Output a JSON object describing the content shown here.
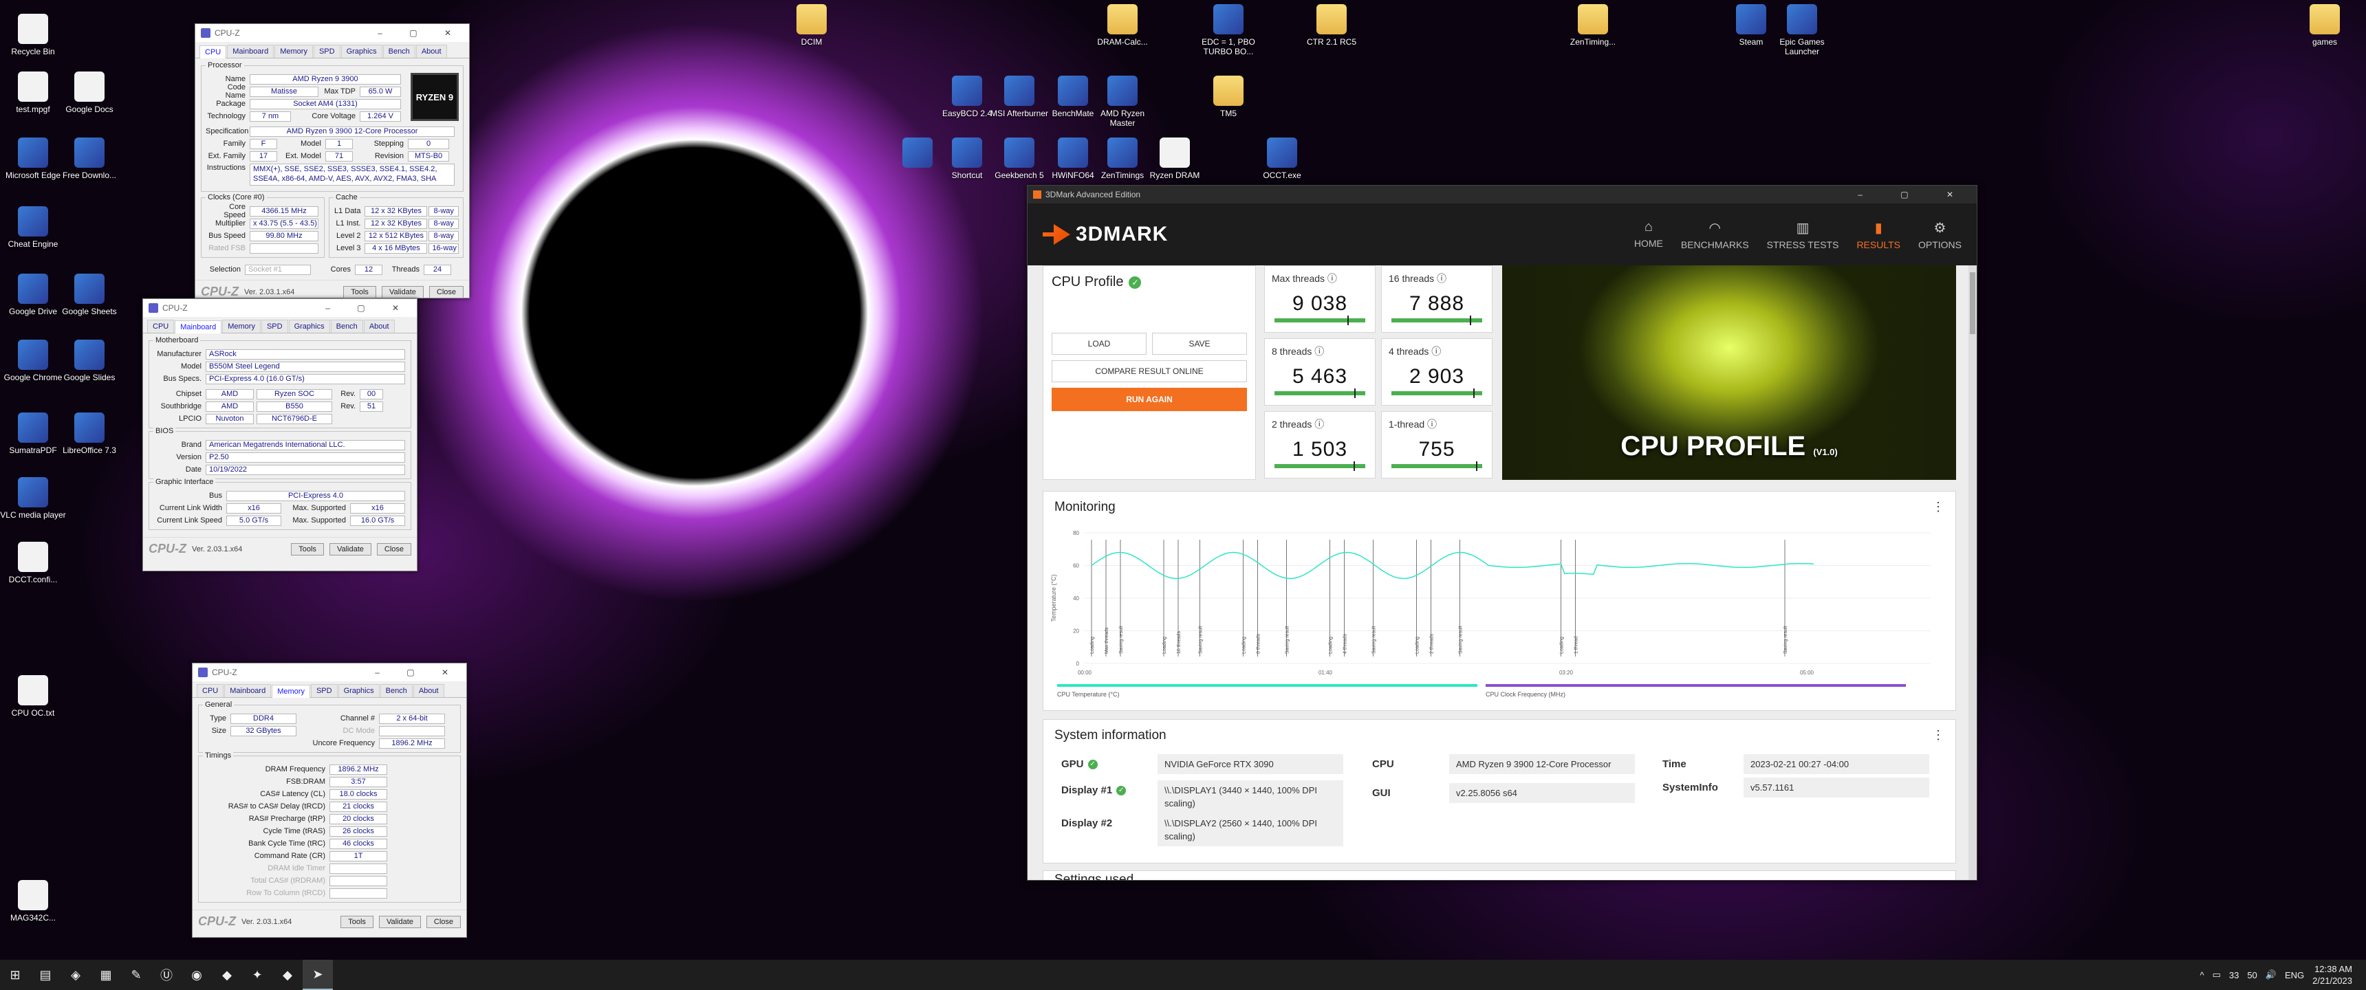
{
  "desktop_icons": [
    {
      "label": "Recycle Bin",
      "icon": "recycle-bin-icon",
      "kind": "file"
    },
    {
      "label": "test.mpgf",
      "icon": "file-icon",
      "kind": "file"
    },
    {
      "label": "Google Docs",
      "icon": "google-docs-icon",
      "kind": "file"
    },
    {
      "label": "Microsoft Edge",
      "icon": "edge-icon",
      "kind": "app"
    },
    {
      "label": "Free Downlo...",
      "icon": "download-icon",
      "kind": "app"
    },
    {
      "label": "Cheat Engine",
      "icon": "cheat-engine-icon",
      "kind": "app"
    },
    {
      "label": "Google Drive",
      "icon": "google-drive-icon",
      "kind": "app"
    },
    {
      "label": "Google Sheets",
      "icon": "google-sheets-icon",
      "kind": "app"
    },
    {
      "label": "Google Chrome",
      "icon": "chrome-icon",
      "kind": "app"
    },
    {
      "label": "Google Slides",
      "icon": "google-slides-icon",
      "kind": "app"
    },
    {
      "label": "SumatraPDF",
      "icon": "pdf-icon",
      "kind": "app"
    },
    {
      "label": "LibreOffice 7.3",
      "icon": "libreoffice-icon",
      "kind": "app"
    },
    {
      "label": "VLC media player",
      "icon": "vlc-icon",
      "kind": "app"
    },
    {
      "label": "DCCT.confi...",
      "icon": "file-icon",
      "kind": "file"
    },
    {
      "label": "CPU OC.txt",
      "icon": "text-file-icon",
      "kind": "file"
    },
    {
      "label": "MAG342C...",
      "icon": "file-icon",
      "kind": "file"
    },
    {
      "label": "DCIM",
      "icon": "folder-icon",
      "kind": "folder"
    },
    {
      "label": "DRAM-Calc...",
      "icon": "folder-icon",
      "kind": "folder"
    },
    {
      "label": "EDC = 1, PBO TURBO BO...",
      "icon": "chrome-icon",
      "kind": "app"
    },
    {
      "label": "CTR 2.1 RC5",
      "icon": "folder-icon",
      "kind": "folder"
    },
    {
      "label": "ZenTiming...",
      "icon": "folder-icon",
      "kind": "folder"
    },
    {
      "label": "Steam",
      "icon": "steam-icon",
      "kind": "app"
    },
    {
      "label": "Epic Games Launcher",
      "icon": "epic-games-icon",
      "kind": "app"
    },
    {
      "label": "games",
      "icon": "folder-icon",
      "kind": "folder"
    },
    {
      "label": "EasyBCD 2.4",
      "icon": "easybcd-icon",
      "kind": "app"
    },
    {
      "label": "MSI Afterburner",
      "icon": "afterburner-icon",
      "kind": "app"
    },
    {
      "label": "BenchMate",
      "icon": "benchmate-icon",
      "kind": "app"
    },
    {
      "label": "AMD Ryzen Master",
      "icon": "ryzen-master-icon",
      "kind": "app"
    },
    {
      "label": "TM5",
      "icon": "folder-icon",
      "kind": "folder"
    },
    {
      "label": "",
      "icon": "app-icon",
      "kind": "app"
    },
    {
      "label": "Shortcut",
      "icon": "shortcut-icon",
      "kind": "app"
    },
    {
      "label": "Geekbench 5",
      "icon": "geekbench-icon",
      "kind": "app"
    },
    {
      "label": "HWiNFO64",
      "icon": "hwinfo-icon",
      "kind": "app"
    },
    {
      "label": "ZenTimings",
      "icon": "zentimings-icon",
      "kind": "app"
    },
    {
      "label": "Ryzen DRAM",
      "icon": "file-icon",
      "kind": "file"
    },
    {
      "label": "OCCT.exe",
      "icon": "occt-icon",
      "kind": "app"
    }
  ],
  "cpuz_cpu": {
    "title": "CPU-Z",
    "tabs": [
      "CPU",
      "Mainboard",
      "Memory",
      "SPD",
      "Graphics",
      "Bench",
      "About"
    ],
    "group_processor": "Processor",
    "name_l": "Name",
    "name": "AMD Ryzen 9 3900",
    "codename_l": "Code Name",
    "codename": "Matisse",
    "maxtdp_l": "Max TDP",
    "maxtdp": "65.0 W",
    "package_l": "Package",
    "package": "Socket AM4 (1331)",
    "tech_l": "Technology",
    "tech": "7 nm",
    "voltage_l": "Core Voltage",
    "voltage": "1.264 V",
    "spec_l": "Specification",
    "spec": "AMD Ryzen 9 3900 12-Core Processor",
    "family_l": "Family",
    "family": "F",
    "model_l": "Model",
    "model": "1",
    "stepping_l": "Stepping",
    "stepping": "0",
    "extfamily_l": "Ext. Family",
    "extfamily": "17",
    "extmodel_l": "Ext. Model",
    "extmodel": "71",
    "revision_l": "Revision",
    "revision": "MTS-B0",
    "instr_l": "Instructions",
    "instr": "MMX(+), SSE, SSE2, SSE3, SSSE3, SSE4.1, SSE4.2, SSE4A, x86-64, AMD-V, AES, AVX, AVX2, FMA3, SHA",
    "group_clocks": "Clocks (Core #0)",
    "group_cache": "Cache",
    "corespeed_l": "Core Speed",
    "corespeed": "4366.15 MHz",
    "mult_l": "Multiplier",
    "mult": "x 43.75 (5.5 - 43.5)",
    "bus_l": "Bus Speed",
    "bus": "99.80 MHz",
    "fsb_l": "Rated FSB",
    "fsb": "",
    "l1d_l": "L1 Data",
    "l1d": "12 x 32 KBytes",
    "l1d_w": "8-way",
    "l1i_l": "L1 Inst.",
    "l1i": "12 x 32 KBytes",
    "l1i_w": "8-way",
    "l2_l": "Level 2",
    "l2": "12 x 512 KBytes",
    "l2_w": "8-way",
    "l3_l": "Level 3",
    "l3": "4 x 16 MBytes",
    "l3_w": "16-way",
    "selection_l": "Selection",
    "selection": "Socket #1",
    "cores_l": "Cores",
    "cores": "12",
    "threads_l": "Threads",
    "threads": "24",
    "logo": "CPU-Z",
    "version": "Ver. 2.03.1.x64",
    "tools": "Tools",
    "validate": "Validate",
    "close": "Close",
    "badge": "RYZEN 9"
  },
  "cpuz_mb": {
    "title": "CPU-Z",
    "tabs": [
      "CPU",
      "Mainboard",
      "Memory",
      "SPD",
      "Graphics",
      "Bench",
      "About"
    ],
    "group_mb": "Motherboard",
    "manu_l": "Manufacturer",
    "manu": "ASRock",
    "model_l": "Model",
    "model": "B550M Steel Legend",
    "busspecs_l": "Bus Specs.",
    "busspecs": "PCI-Express 4.0 (16.0 GT/s)",
    "chipset_l": "Chipset",
    "chipset_a": "AMD",
    "chipset_b": "Ryzen SOC",
    "chipset_rev_l": "Rev.",
    "chipset_rev": "00",
    "south_l": "Southbridge",
    "south_a": "AMD",
    "south_b": "B550",
    "south_rev_l": "Rev.",
    "south_rev": "51",
    "lpcio_l": "LPCIO",
    "lpcio_a": "Nuvoton",
    "lpcio_b": "NCT6796D-E",
    "group_bios": "BIOS",
    "brand_l": "Brand",
    "brand": "American Megatrends International LLC.",
    "ver_l": "Version",
    "ver": "P2.50",
    "date_l": "Date",
    "date": "10/19/2022",
    "group_gi": "Graphic Interface",
    "gbus_l": "Bus",
    "gbus": "PCI-Express 4.0",
    "clw_l": "Current Link Width",
    "clw": "x16",
    "msw_l": "Max. Supported",
    "msw": "x16",
    "cls_l": "Current Link Speed",
    "cls": "5.0 GT/s",
    "mss_l": "Max. Supported",
    "mss": "16.0 GT/s",
    "logo": "CPU-Z",
    "version": "Ver. 2.03.1.x64",
    "tools": "Tools",
    "validate": "Validate",
    "close": "Close"
  },
  "cpuz_mem": {
    "title": "CPU-Z",
    "tabs": [
      "CPU",
      "Mainboard",
      "Memory",
      "SPD",
      "Graphics",
      "Bench",
      "About"
    ],
    "group_general": "General",
    "type_l": "Type",
    "type": "DDR4",
    "chan_l": "Channel #",
    "chan": "2 x 64-bit",
    "size_l": "Size",
    "size": "32 GBytes",
    "dcmode_l": "DC Mode",
    "dcmode": "",
    "uncore_l": "Uncore Frequency",
    "uncore": "1896.2 MHz",
    "group_timings": "Timings",
    "timings": [
      {
        "l": "DRAM Frequency",
        "v": "1896.2 MHz",
        "dim": false
      },
      {
        "l": "FSB:DRAM",
        "v": "3:57",
        "dim": false
      },
      {
        "l": "CAS# Latency (CL)",
        "v": "18.0 clocks",
        "dim": false
      },
      {
        "l": "RAS# to CAS# Delay (tRCD)",
        "v": "21 clocks",
        "dim": false
      },
      {
        "l": "RAS# Precharge (tRP)",
        "v": "20 clocks",
        "dim": false
      },
      {
        "l": "Cycle Time (tRAS)",
        "v": "26 clocks",
        "dim": false
      },
      {
        "l": "Bank Cycle Time (tRC)",
        "v": "46 clocks",
        "dim": false
      },
      {
        "l": "Command Rate (CR)",
        "v": "1T",
        "dim": false
      },
      {
        "l": "DRAM Idle Timer",
        "v": "",
        "dim": true
      },
      {
        "l": "Total CAS# (tRDRAM)",
        "v": "",
        "dim": true
      },
      {
        "l": "Row To Column (tRCD)",
        "v": "",
        "dim": true
      }
    ],
    "logo": "CPU-Z",
    "version": "Ver. 2.03.1.x64",
    "tools": "Tools",
    "validate": "Validate",
    "close": "Close"
  },
  "tdm": {
    "window_title": "3DMark Advanced Edition",
    "logo": "3DMARK",
    "nav": [
      {
        "label": "HOME",
        "icon": "home-icon",
        "glyph": "⌂",
        "active": false
      },
      {
        "label": "BENCHMARKS",
        "icon": "benchmarks-icon",
        "glyph": "◠",
        "active": false
      },
      {
        "label": "STRESS TESTS",
        "icon": "stress-tests-icon",
        "glyph": "▥",
        "active": false
      },
      {
        "label": "RESULTS",
        "icon": "results-icon",
        "glyph": "▮",
        "active": true
      },
      {
        "label": "OPTIONS",
        "icon": "options-icon",
        "glyph": "⚙",
        "active": false
      }
    ],
    "test_name": "CPU Profile",
    "load": "LOAD",
    "save": "SAVE",
    "compare": "COMPARE RESULT ONLINE",
    "run_again": "RUN AGAIN",
    "scores": [
      {
        "label": "Max threads",
        "value": "9 038",
        "marker": 0.8
      },
      {
        "label": "16 threads",
        "value": "7 888",
        "marker": 0.86
      },
      {
        "label": "8 threads",
        "value": "5 463",
        "marker": 0.88
      },
      {
        "label": "4 threads",
        "value": "2 903",
        "marker": 0.9
      },
      {
        "label": "2 threads",
        "value": "1 503",
        "marker": 0.87
      },
      {
        "label": "1-thread",
        "value": "755",
        "marker": 0.93
      }
    ],
    "hero_title": "CPU PROFILE",
    "hero_ver": "(V1.0)",
    "monitoring": {
      "title": "Monitoring",
      "ylabel": "Temperature (°C)",
      "yticks": [
        "80",
        "60",
        "40",
        "20",
        "0"
      ],
      "xticks": [
        "00:00",
        "01:40",
        "03:20",
        "05:00"
      ],
      "markers": [
        "Loading",
        "Max threads",
        "Saving result",
        "Loading",
        "16 threads",
        "Saving result",
        "Loading",
        "8 threads",
        "Saving result",
        "Loading",
        "4 threads",
        "Saving result",
        "Loading",
        "2 threads",
        "Saving result",
        "Loading",
        "1 thread",
        "Saving result"
      ],
      "legend": [
        {
          "label": "CPU Temperature (°C)",
          "color": "#2ee6c5"
        },
        {
          "label": "CPU Clock Frequency (MHz)",
          "color": "#8a4fd0"
        }
      ],
      "color_temp": "#2ee6c5"
    },
    "sysinfo": {
      "title": "System information",
      "gpu_l": "GPU",
      "gpu": "NVIDIA GeForce RTX 3090",
      "d1_l": "Display #1",
      "d1": "\\\\.\\DISPLAY1 (3440 × 1440, 100% DPI scaling)",
      "d2_l": "Display #2",
      "d2": "\\\\.\\DISPLAY2 (2560 × 1440, 100% DPI scaling)",
      "cpu_l": "CPU",
      "cpu": "AMD Ryzen 9 3900 12-Core Processor",
      "gui_l": "GUI",
      "gui": "v2.25.8056 s64",
      "time_l": "Time",
      "time": "2023-02-21 00:27 -04:00",
      "si_l": "SystemInfo",
      "si": "v5.57.1161"
    },
    "next_section": "Settings used"
  },
  "taskbar": {
    "icons": [
      "windows-start-icon",
      "file-explorer-icon",
      "visual-studio-icon",
      "calculator-icon",
      "notepad-icon",
      "unreal-icon",
      "chrome-icon",
      "app-icon",
      "steam-icon",
      "app-icon",
      "3dmark-icon"
    ],
    "tray_temp": "33",
    "tray_temp2": "50",
    "lang": "ENG",
    "time": "12:38 AM",
    "date": "2/21/2023"
  },
  "colors": {
    "accent": "#f37021",
    "green": "#4caf50",
    "teal": "#2ee6c5",
    "purple": "#8a4fd0"
  }
}
